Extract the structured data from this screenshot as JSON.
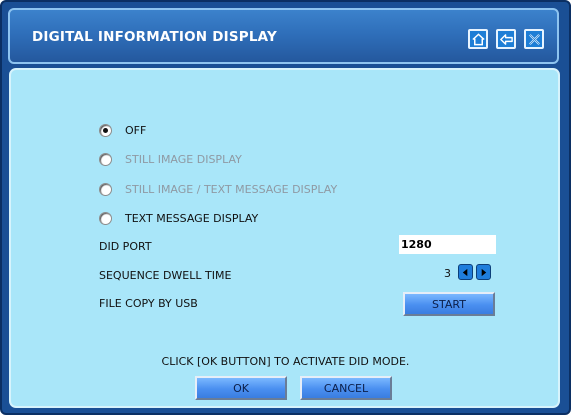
{
  "window": {
    "title": "DIGITAL INFORMATION DISPLAY",
    "buttons": [
      "home-icon",
      "back-arrow-icon",
      "close-icon"
    ]
  },
  "options": [
    {
      "label": "OFF",
      "checked": true,
      "enabled": true
    },
    {
      "label": "STILL IMAGE DISPLAY",
      "checked": false,
      "enabled": false
    },
    {
      "label": "STILL IMAGE / TEXT MESSAGE DISPLAY",
      "checked": false,
      "enabled": false
    },
    {
      "label": "TEXT MESSAGE DISPLAY",
      "checked": false,
      "enabled": true
    }
  ],
  "settings": {
    "did_port_label": "DID PORT",
    "did_port_value": "1280",
    "dwell_label": "SEQUENCE DWELL TIME",
    "dwell_value": "3",
    "file_copy_label": "FILE COPY BY USB",
    "start_label": "START"
  },
  "footer": {
    "notice": "CLICK [OK BUTTON] TO ACTIVATE DID MODE.",
    "ok_label": "OK",
    "cancel_label": "CANCEL"
  },
  "colors": {
    "frame": "#1a4f95",
    "titlebar": "#2f6fba",
    "panel": "#a9e6f9",
    "button": "#4a8ff0"
  }
}
